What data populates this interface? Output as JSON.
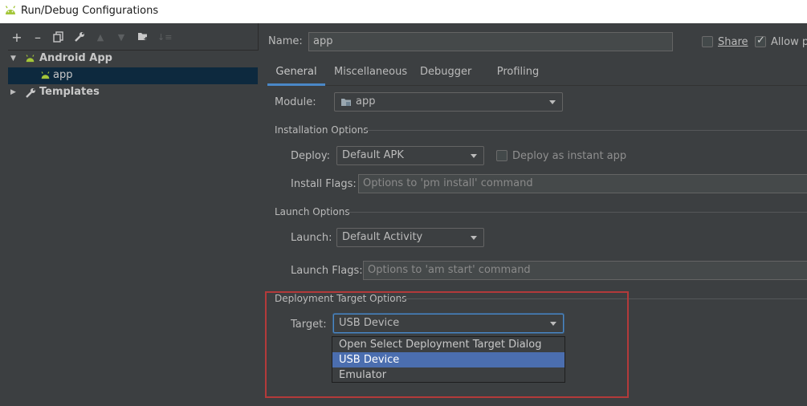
{
  "window": {
    "title": "Run/Debug Configurations",
    "icon": "android-icon"
  },
  "toolbar": {
    "buttons": [
      "add-icon",
      "remove-icon",
      "copy-icon",
      "wrench-icon",
      "move-up-icon",
      "move-down-icon",
      "new-folder-icon",
      "sort-icon"
    ]
  },
  "tree": {
    "android_app": "Android App",
    "app": "app",
    "templates": "Templates"
  },
  "header": {
    "name_label": "Name:",
    "name_value": "app",
    "share_label": "Share",
    "allow_label": "Allow pa"
  },
  "tabs": [
    "General",
    "Miscellaneous",
    "Debugger",
    "Profiling"
  ],
  "general": {
    "module_label": "Module:",
    "module_value": "app",
    "installation_title": "Installation Options",
    "deploy_label": "Deploy:",
    "deploy_value": "Default APK",
    "instant_app_label": "Deploy as instant app",
    "install_flags_label": "Install Flags:",
    "install_flags_placeholder": "Options to 'pm install' command",
    "launch_title": "Launch Options",
    "launch_label": "Launch:",
    "launch_value": "Default Activity",
    "launch_flags_label": "Launch Flags:",
    "launch_flags_placeholder": "Options to 'am start' command",
    "deployment_title": "Deployment Target Options",
    "target_label": "Target:",
    "target_value": "USB Device",
    "target_options": [
      "Open Select Deployment Target Dialog",
      "USB Device",
      "Emulator"
    ]
  },
  "colors": {
    "background": "#3c3f41",
    "selection": "#0d293e",
    "accent": "#4a88c7",
    "dropdown_selected": "#4b6eaf",
    "highlight_border": "#b33a3a",
    "android_green": "#a4c639"
  }
}
